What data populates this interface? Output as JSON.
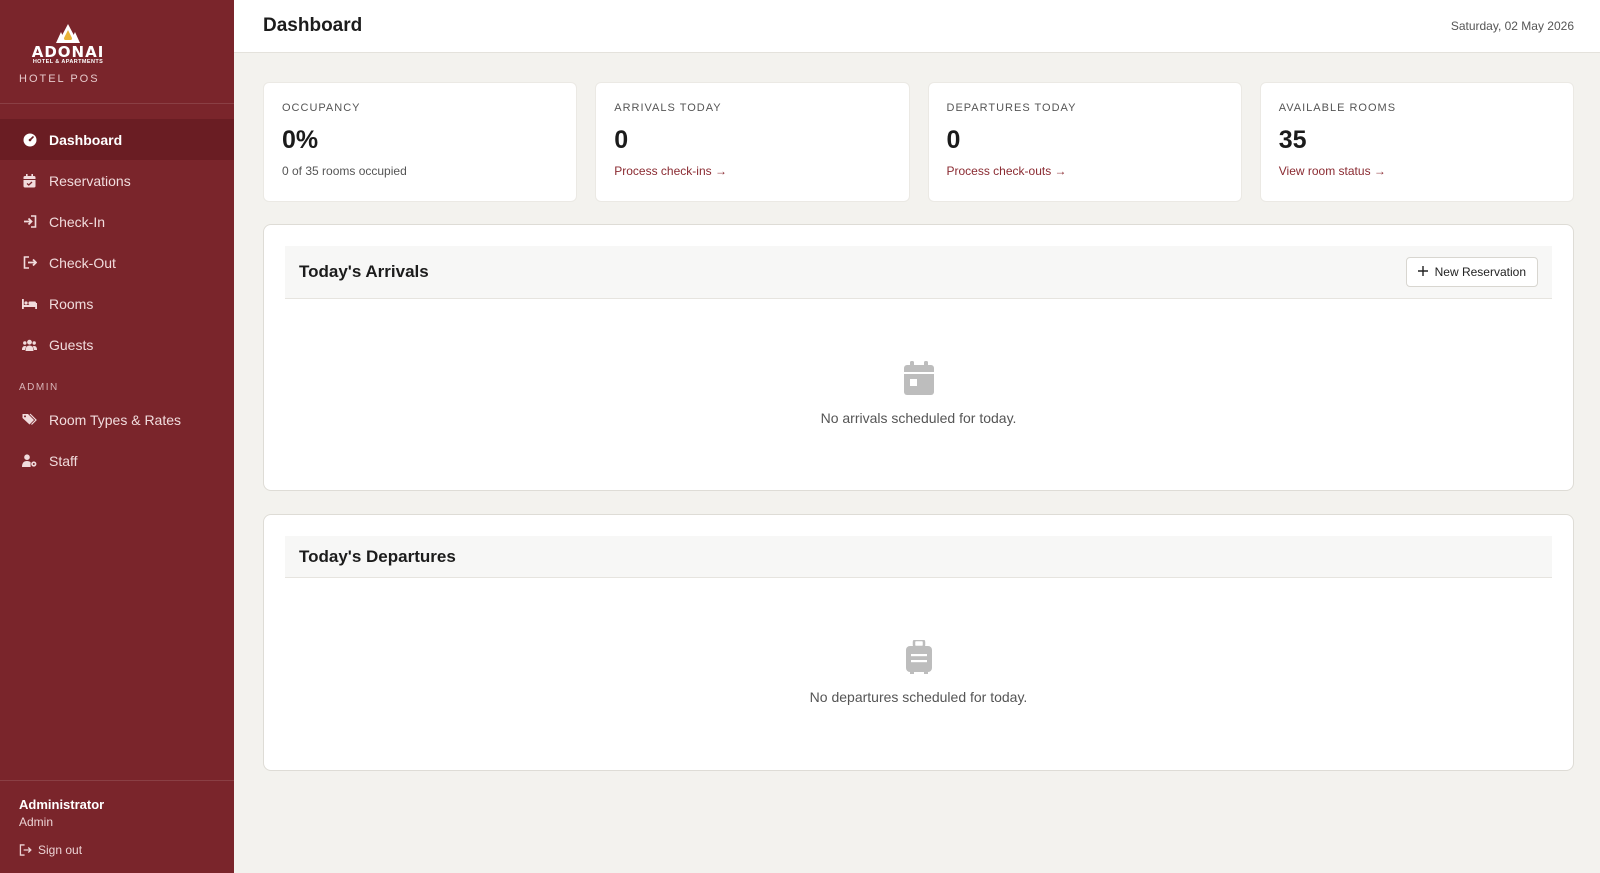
{
  "sidebar": {
    "logo_name": "ADONAI",
    "logo_sub": "HOTEL & APARTMENTS",
    "app_name": "HOTEL POS",
    "items": [
      {
        "label": "Dashboard",
        "icon": "gauge-icon",
        "active": true
      },
      {
        "label": "Reservations",
        "icon": "calendar-check-icon"
      },
      {
        "label": "Check-In",
        "icon": "sign-in-icon"
      },
      {
        "label": "Check-Out",
        "icon": "sign-out-icon"
      },
      {
        "label": "Rooms",
        "icon": "bed-icon"
      },
      {
        "label": "Guests",
        "icon": "users-icon"
      }
    ],
    "admin_section": "ADMIN",
    "admin_items": [
      {
        "label": "Room Types & Rates",
        "icon": "tags-icon"
      },
      {
        "label": "Staff",
        "icon": "user-gear-icon"
      }
    ],
    "user": {
      "name": "Administrator",
      "role": "Admin",
      "signout": "Sign out"
    }
  },
  "header": {
    "title": "Dashboard",
    "date": "Saturday, 02 May 2026"
  },
  "stats": [
    {
      "label": "OCCUPANCY",
      "value": "0%",
      "sub": "0 of 35 rooms occupied"
    },
    {
      "label": "ARRIVALS TODAY",
      "value": "0",
      "link": "Process check-ins →"
    },
    {
      "label": "DEPARTURES TODAY",
      "value": "0",
      "link": "Process check-outs →"
    },
    {
      "label": "AVAILABLE ROOMS",
      "value": "35",
      "link": "View room status →"
    }
  ],
  "arrivals": {
    "title": "Today's Arrivals",
    "button": "New Reservation",
    "empty": "No arrivals scheduled for today."
  },
  "departures": {
    "title": "Today's Departures",
    "empty": "No departures scheduled for today."
  },
  "colors": {
    "sidebar": "#7a252b",
    "sidebar_active": "#6a1d23",
    "link": "#8a2a31",
    "background": "#f3f2ee"
  }
}
